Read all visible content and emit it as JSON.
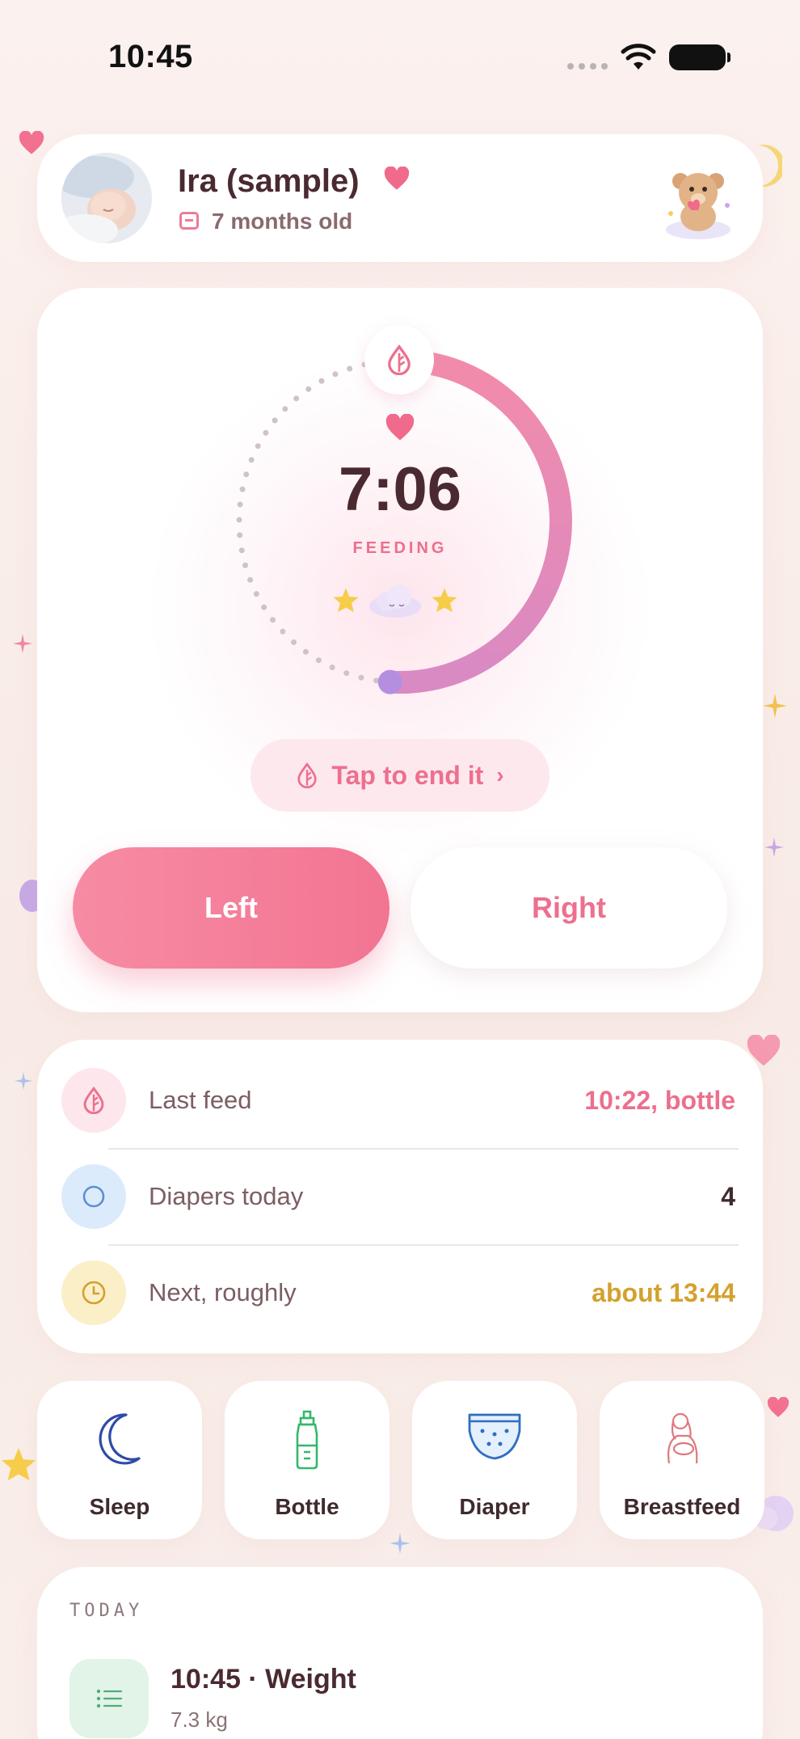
{
  "status_bar": {
    "time": "10:45"
  },
  "header": {
    "name": "Ira (sample)",
    "age": "7 months old"
  },
  "timer": {
    "value": "7:06",
    "label": "FEEDING",
    "progress": 0.47
  },
  "end_action": {
    "label": "Tap to end it"
  },
  "sides": {
    "left": "Left",
    "right": "Right",
    "active": "Left"
  },
  "stats": [
    {
      "label": "Last feed",
      "value": "10:22, bottle",
      "color": "#ec6f8d"
    },
    {
      "label": "Diapers today",
      "value": "4",
      "color": "#3e2a2d"
    },
    {
      "label": "Next, roughly",
      "value": "about 13:44",
      "color": "#d3a12e"
    }
  ],
  "quick_actions": [
    {
      "label": "Sleep",
      "icon": "moon-icon"
    },
    {
      "label": "Bottle",
      "icon": "bottle-icon"
    },
    {
      "label": "Diaper",
      "icon": "diaper-icon"
    },
    {
      "label": "Breastfeed",
      "icon": "breastfeed-icon"
    }
  ],
  "today": {
    "title": "TODAY",
    "entries": [
      {
        "time_title": "10:45 · Weight",
        "detail": "7.3 kg"
      }
    ]
  },
  "colors": {
    "accent": "#f27592",
    "accent_soft": "#fde8ee",
    "bg": "#fbf1ee"
  }
}
